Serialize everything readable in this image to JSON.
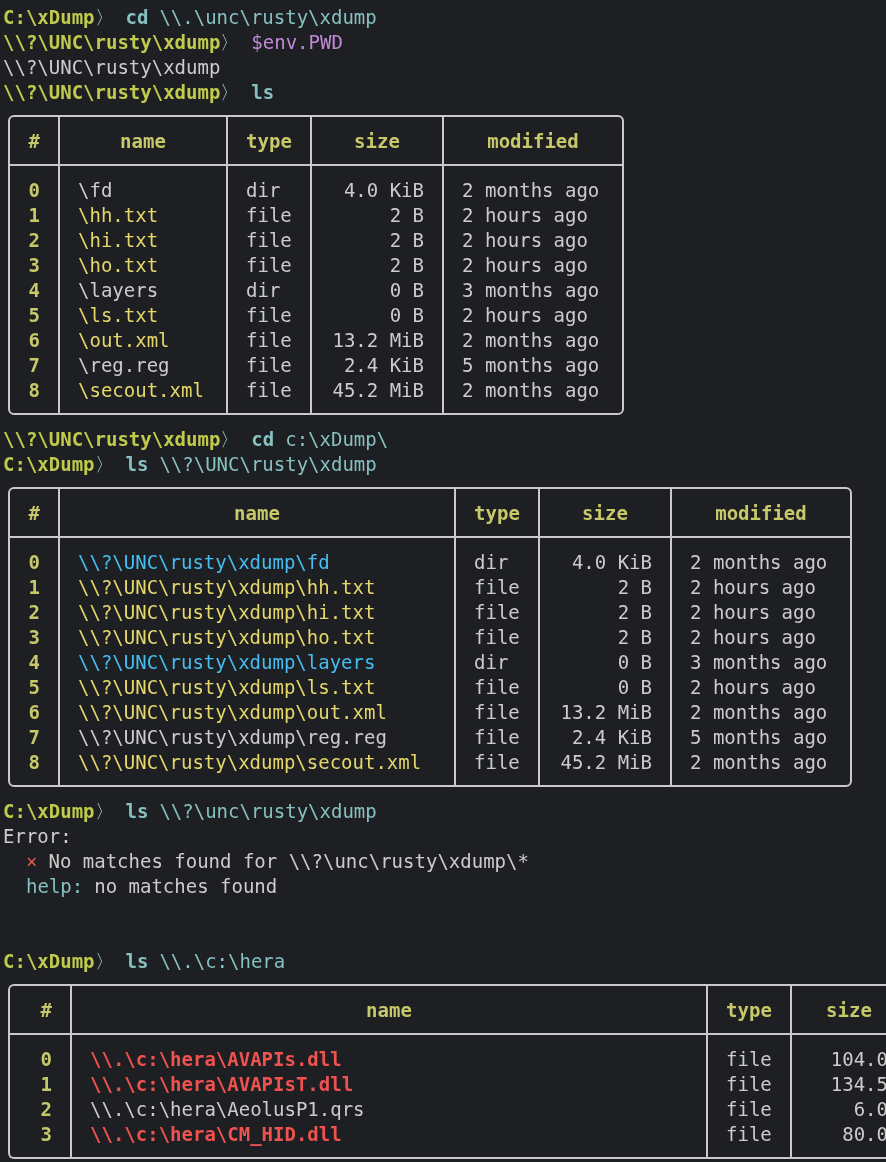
{
  "terminal": [
    {
      "kind": "prompt",
      "path": "C:\\xDump",
      "indicator": "〉",
      "tokens": [
        {
          "text": "cd",
          "kind": "command"
        },
        {
          "text": "\\\\.\\unc\\rusty\\xdump",
          "kind": "argument"
        }
      ]
    },
    {
      "kind": "prompt",
      "path": "\\\\?\\UNC\\rusty\\xdump",
      "indicator": "〉",
      "tokens": [
        {
          "text": "$env.PWD",
          "kind": "variable"
        }
      ]
    },
    {
      "kind": "output",
      "text": "\\\\?\\UNC\\rusty\\xdump"
    },
    {
      "kind": "prompt",
      "path": "\\\\?\\UNC\\rusty\\xdump",
      "indicator": "〉",
      "tokens": [
        {
          "text": "ls",
          "kind": "command"
        }
      ]
    },
    {
      "kind": "table",
      "columns": [
        "#",
        "name",
        "type",
        "size",
        "modified"
      ],
      "rows": [
        {
          "index": "0",
          "name": "\\fd",
          "kind": "plain",
          "type": "dir",
          "size": "4.0 KiB",
          "modified": "2 months ago"
        },
        {
          "index": "1",
          "name": "\\hh.txt",
          "kind": "text",
          "type": "file",
          "size": "2 B",
          "modified": "2 hours ago"
        },
        {
          "index": "2",
          "name": "\\hi.txt",
          "kind": "text",
          "type": "file",
          "size": "2 B",
          "modified": "2 hours ago"
        },
        {
          "index": "3",
          "name": "\\ho.txt",
          "kind": "text",
          "type": "file",
          "size": "2 B",
          "modified": "2 hours ago"
        },
        {
          "index": "4",
          "name": "\\layers",
          "kind": "plain",
          "type": "dir",
          "size": "0 B",
          "modified": "3 months ago"
        },
        {
          "index": "5",
          "name": "\\ls.txt",
          "kind": "text",
          "type": "file",
          "size": "0 B",
          "modified": "2 hours ago"
        },
        {
          "index": "6",
          "name": "\\out.xml",
          "kind": "text",
          "type": "file",
          "size": "13.2 MiB",
          "modified": "2 months ago"
        },
        {
          "index": "7",
          "name": "\\reg.reg",
          "kind": "plain",
          "type": "file",
          "size": "2.4 KiB",
          "modified": "5 months ago"
        },
        {
          "index": "8",
          "name": "\\secout.xml",
          "kind": "text",
          "type": "file",
          "size": "45.2 MiB",
          "modified": "2 months ago"
        }
      ]
    },
    {
      "kind": "prompt",
      "path": "\\\\?\\UNC\\rusty\\xdump",
      "indicator": "〉",
      "tokens": [
        {
          "text": "cd",
          "kind": "command"
        },
        {
          "text": "c:\\xDump\\",
          "kind": "argument"
        }
      ]
    },
    {
      "kind": "prompt",
      "path": "C:\\xDump",
      "indicator": "〉",
      "tokens": [
        {
          "text": "ls",
          "kind": "command"
        },
        {
          "text": "\\\\?\\UNC\\rusty\\xdump",
          "kind": "argument"
        }
      ]
    },
    {
      "kind": "table",
      "columns": [
        "#",
        "name",
        "type",
        "size",
        "modified"
      ],
      "rows": [
        {
          "index": "0",
          "name": "\\\\?\\UNC\\rusty\\xdump\\fd",
          "kind": "dir",
          "type": "dir",
          "size": "4.0 KiB",
          "modified": "2 months ago"
        },
        {
          "index": "1",
          "name": "\\\\?\\UNC\\rusty\\xdump\\hh.txt",
          "kind": "text",
          "type": "file",
          "size": "2 B",
          "modified": "2 hours ago"
        },
        {
          "index": "2",
          "name": "\\\\?\\UNC\\rusty\\xdump\\hi.txt",
          "kind": "text",
          "type": "file",
          "size": "2 B",
          "modified": "2 hours ago"
        },
        {
          "index": "3",
          "name": "\\\\?\\UNC\\rusty\\xdump\\ho.txt",
          "kind": "text",
          "type": "file",
          "size": "2 B",
          "modified": "2 hours ago"
        },
        {
          "index": "4",
          "name": "\\\\?\\UNC\\rusty\\xdump\\layers",
          "kind": "dir",
          "type": "dir",
          "size": "0 B",
          "modified": "3 months ago"
        },
        {
          "index": "5",
          "name": "\\\\?\\UNC\\rusty\\xdump\\ls.txt",
          "kind": "text",
          "type": "file",
          "size": "0 B",
          "modified": "2 hours ago"
        },
        {
          "index": "6",
          "name": "\\\\?\\UNC\\rusty\\xdump\\out.xml",
          "kind": "text",
          "type": "file",
          "size": "13.2 MiB",
          "modified": "2 months ago"
        },
        {
          "index": "7",
          "name": "\\\\?\\UNC\\rusty\\xdump\\reg.reg",
          "kind": "plain",
          "type": "file",
          "size": "2.4 KiB",
          "modified": "5 months ago"
        },
        {
          "index": "8",
          "name": "\\\\?\\UNC\\rusty\\xdump\\secout.xml",
          "kind": "text",
          "type": "file",
          "size": "45.2 MiB",
          "modified": "2 months ago"
        }
      ]
    },
    {
      "kind": "prompt",
      "path": "C:\\xDump",
      "indicator": "〉",
      "tokens": [
        {
          "text": "ls",
          "kind": "command"
        },
        {
          "text": "\\\\?\\unc\\rusty\\xdump",
          "kind": "argument"
        }
      ]
    },
    {
      "kind": "error",
      "title": "Error:",
      "mark": "×",
      "message": "No matches found for \\\\?\\unc\\rusty\\xdump\\*",
      "help_label": "help:",
      "help": "no matches found"
    },
    {
      "kind": "blank"
    },
    {
      "kind": "blank"
    },
    {
      "kind": "prompt",
      "path": "C:\\xDump",
      "indicator": "〉",
      "tokens": [
        {
          "text": "ls",
          "kind": "command"
        },
        {
          "text": "\\\\.\\c:\\hera",
          "kind": "argument"
        }
      ]
    },
    {
      "kind": "table",
      "columns": [
        "#",
        "name",
        "type",
        "size"
      ],
      "rows": [
        {
          "index": "0",
          "name": "\\\\.\\c:\\hera\\AVAPIs.dll",
          "kind": "binary",
          "type": "file",
          "size": "104.0"
        },
        {
          "index": "1",
          "name": "\\\\.\\c:\\hera\\AVAPIsT.dll",
          "kind": "binary",
          "type": "file",
          "size": "134.5"
        },
        {
          "index": "2",
          "name": "\\\\.\\c:\\hera\\AeolusP1.qrs",
          "kind": "plain",
          "type": "file",
          "size": "6.0"
        },
        {
          "index": "3",
          "name": "\\\\.\\c:\\hera\\CM_HID.dll",
          "kind": "binary",
          "type": "file",
          "size": "80.0"
        }
      ]
    }
  ]
}
